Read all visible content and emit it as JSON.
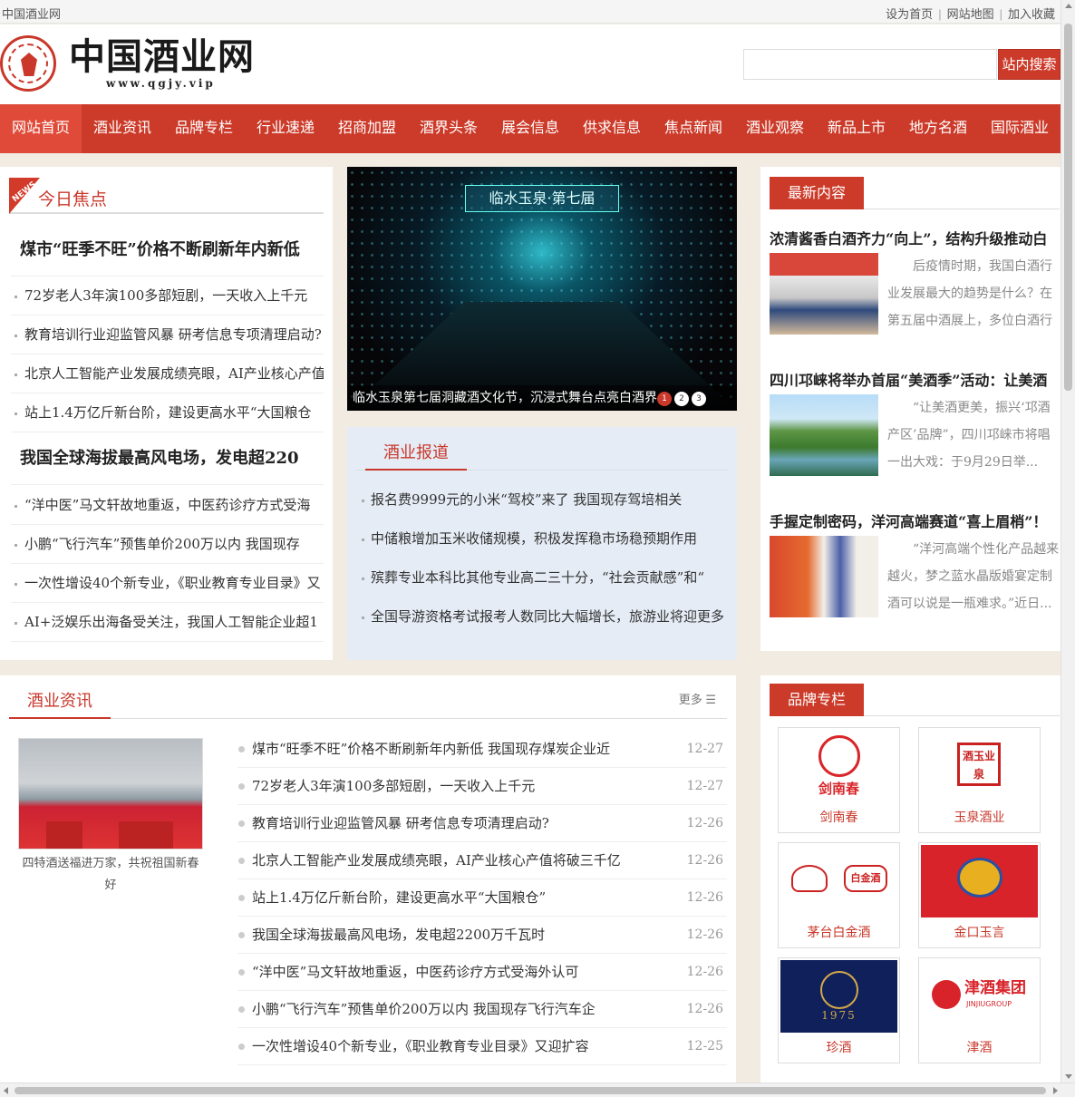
{
  "topbar": {
    "site_name": "中国酒业网",
    "links": [
      "设为首页",
      "网站地图",
      "加入收藏"
    ]
  },
  "header": {
    "logo_text": "中国酒业网",
    "logo_url": "www.qgjy.vip",
    "search_placeholder": "",
    "search_button": "站内搜索"
  },
  "nav": [
    "网站首页",
    "酒业资讯",
    "品牌专栏",
    "行业速递",
    "招商加盟",
    "酒界头条",
    "展会信息",
    "供求信息",
    "焦点新闻",
    "酒业观察",
    "新品上市",
    "地方名酒",
    "国际酒业"
  ],
  "focus": {
    "tag": "NEWS",
    "title": "今日焦点",
    "headline1": "煤市“旺季不旺”价格不断刷新年内新低",
    "list1": [
      "72岁老人3年演100多部短剧，一天收入上千元",
      "教育培训行业迎监管风暴 研考信息专项清理启动?",
      "北京人工智能产业发展成绩亮眼，AI产业核心产值",
      "站上1.4万亿斤新台阶，建设更高水平“大国粮仓"
    ],
    "headline2": "我国全球海拔最高风电场，发电超220",
    "list2": [
      "“洋中医”马文轩故地重返，中医药诊疗方式受海",
      "小鹏“飞行汽车”预售单价200万以内 我国现存",
      "一次性增设40个新专业，《职业教育专业目录》又",
      "AI+泛娱乐出海备受关注，我国人工智能企业超1"
    ]
  },
  "slider": {
    "sign_text": "临水玉泉·第七届",
    "caption": "临水玉泉第七届洞藏酒文化节，沉浸式舞台点亮白酒界",
    "pages": [
      "1",
      "2",
      "3"
    ]
  },
  "report": {
    "title": "酒业报道",
    "items": [
      "报名费9999元的小米“驾校”来了 我国现存驾培相关",
      "中储粮增加玉米收储规模，积极发挥稳市场稳预期作用",
      "殡葬专业本科比其他专业高二三十分，“社会贡献感”和“",
      "全国导游资格考试报考人数同比大幅增长，旅游业将迎更多"
    ]
  },
  "latest": {
    "tab": "最新内容",
    "items": [
      {
        "title": "浓清酱香白酒齐力“向上”，结构升级推动白",
        "desc": "后疫情时期，我国白酒行业发展最大的趋势是什么？在第五届中酒展上，多位白酒行"
      },
      {
        "title": "四川邛崃将举办首届“美酒季”活动：让美酒",
        "desc": "“让美酒更美，振兴‘邛酒产区’品牌”，四川邛崃市将唱一出大戏：于9月29日举..."
      },
      {
        "title": "手握定制密码，洋河高端赛道“喜上眉梢”！",
        "desc": "“洋河高端个性化产品越来越火，梦之蓝水晶版婚宴定制酒可以说是一瓶难求。”近日..."
      }
    ]
  },
  "news": {
    "title": "酒业资讯",
    "more": "更多 ☰",
    "pic_caption": "四特酒送福进万家，共祝祖国新春好",
    "items": [
      {
        "title": "煤市“旺季不旺”价格不断刷新年内新低 我国现存煤炭企业近",
        "date": "12-27"
      },
      {
        "title": "72岁老人3年演100多部短剧，一天收入上千元",
        "date": "12-27"
      },
      {
        "title": "教育培训行业迎监管风暴 研考信息专项清理启动?",
        "date": "12-26"
      },
      {
        "title": "北京人工智能产业发展成绩亮眼，AI产业核心产值将破三千亿",
        "date": "12-26"
      },
      {
        "title": "站上1.4万亿斤新台阶，建设更高水平“大国粮仓”",
        "date": "12-26"
      },
      {
        "title": "我国全球海拔最高风电场，发电超2200万千瓦时",
        "date": "12-26"
      },
      {
        "title": "“洋中医”马文轩故地重返，中医药诊疗方式受海外认可",
        "date": "12-26"
      },
      {
        "title": "小鹏“飞行汽车”预售单价200万以内 我国现存飞行汽车企",
        "date": "12-26"
      },
      {
        "title": "一次性增设40个新专业，《职业教育专业目录》又迎扩容",
        "date": "12-25"
      }
    ]
  },
  "brands": {
    "tab": "品牌专栏",
    "items": [
      {
        "name": "剑南春",
        "logo_text": "剑南春"
      },
      {
        "name": "玉泉酒业",
        "logo_text": "酒玉业泉"
      },
      {
        "name": "茅台白金酒",
        "logo_text": "白金酒"
      },
      {
        "name": "金口玉言",
        "logo_text": ""
      },
      {
        "name": "珍酒",
        "logo_text": "1975"
      },
      {
        "name": "津酒",
        "logo_text": "津酒集团",
        "logo_sub": "JINJIUGROUP"
      }
    ]
  }
}
